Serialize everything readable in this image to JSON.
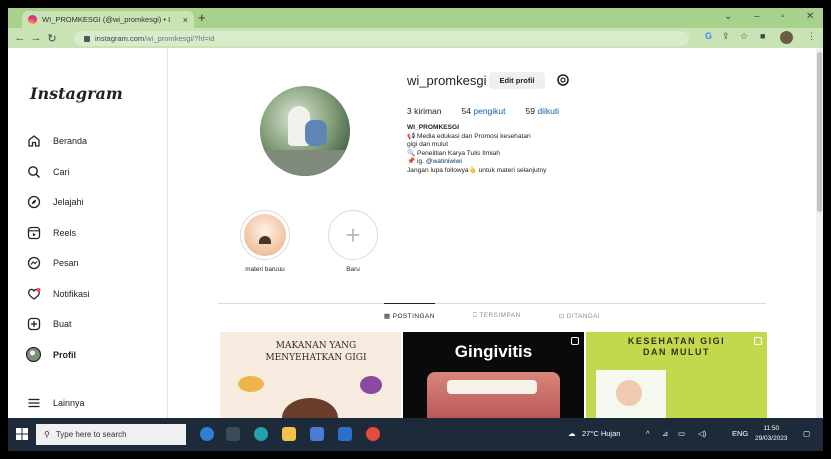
{
  "browser": {
    "tab_title": "WI_PROMKESGI (@wi_promkesgi) • I",
    "tab_close": "×",
    "new_tab": "+",
    "url_host": "instagram.com",
    "url_path": "/wi_promkesgi/?hl=id",
    "min": "⌄",
    "dash": "–",
    "restore": "▫",
    "close": "✕"
  },
  "sidebar": {
    "logo": "Instagram",
    "items": [
      {
        "label": "Beranda",
        "icon": "home-icon"
      },
      {
        "label": "Cari",
        "icon": "search-icon"
      },
      {
        "label": "Jelajahi",
        "icon": "compass-icon"
      },
      {
        "label": "Reels",
        "icon": "reels-icon"
      },
      {
        "label": "Pesan",
        "icon": "messenger-icon"
      },
      {
        "label": "Notifikasi",
        "icon": "heart-icon"
      },
      {
        "label": "Buat",
        "icon": "plus-square-icon"
      },
      {
        "label": "Profil",
        "icon": "avatar-icon"
      },
      {
        "label": "Lainnya",
        "icon": "menu-icon"
      }
    ]
  },
  "profile": {
    "username": "wi_promkesgi",
    "edit_label": "Edit profil",
    "posts_num": "3",
    "posts_label": "kiriman",
    "followers_num": "54",
    "followers_label": "pengikut",
    "following_num": "59",
    "following_label": "diikuti",
    "bio_name": "WI_PROMKESGI",
    "bio_lines": [
      "📢 Media edukasi dan Promosi kesehatan",
      "gigi dan mulut",
      "🔍 Penelitian Karya Tulis Ilmiah",
      "📌 ig. ",
      "Jangan lupa followya👆 untuk materi selanjutny"
    ],
    "bio_tag": "@watiniwiwi"
  },
  "highlights": [
    {
      "label": "materi baruuu"
    },
    {
      "label": "Baru"
    }
  ],
  "tabs": [
    {
      "label": "POSTINGAN",
      "icon": "grid-icon"
    },
    {
      "label": "TERSIMPAN",
      "icon": "bookmark-icon"
    },
    {
      "label": "DITANDAI",
      "icon": "tag-icon"
    }
  ],
  "posts": [
    {
      "title_1": "MAKANAN YANG",
      "title_2": "MENYEHATKAN GIGI"
    },
    {
      "title": "Gingivitis"
    },
    {
      "title_1": "KESEHATAN GIGI",
      "title_2": "DAN MULUT"
    }
  ],
  "taskbar": {
    "search_placeholder": "Type here to search",
    "weather": "27°C  Hujan",
    "lang": "ENG",
    "time": "11:50",
    "date": "29/03/2023"
  }
}
